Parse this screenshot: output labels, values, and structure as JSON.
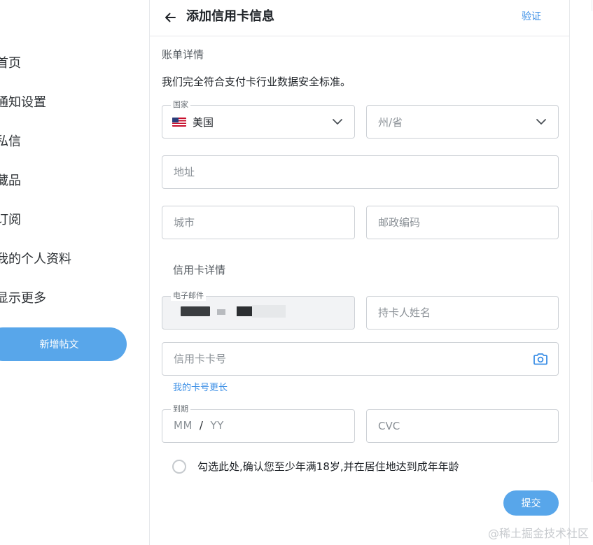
{
  "sidebar": {
    "items": [
      {
        "label": "首页"
      },
      {
        "label": "通知设置"
      },
      {
        "label": "私信"
      },
      {
        "label": "藏品"
      },
      {
        "label": "订阅"
      },
      {
        "label": "我的个人资料"
      },
      {
        "label": "显示更多"
      }
    ],
    "post_button": "新增帖文"
  },
  "header": {
    "title": "添加信用卡信息",
    "verify_label": "验证",
    "back_icon": "arrow-left-icon"
  },
  "billing": {
    "section_title": "账单详情",
    "note": "我们完全符合支付卡行业数据安全标准。",
    "country": {
      "label": "国家",
      "value": "美国",
      "flag_icon": "us-flag-icon"
    },
    "state": {
      "placeholder": "州/省"
    },
    "address": {
      "placeholder": "地址"
    },
    "city": {
      "placeholder": "城市"
    },
    "zip": {
      "placeholder": "邮政编码"
    }
  },
  "card": {
    "section_title": "信用卡详情",
    "email": {
      "label": "电子邮件",
      "value": ""
    },
    "holder": {
      "placeholder": "持卡人姓名"
    },
    "number": {
      "placeholder": "信用卡卡号",
      "camera_icon": "camera-icon"
    },
    "longer_link": "我的卡号更长",
    "expiry": {
      "label": "到期",
      "month": "MM",
      "slash": "/",
      "year": "YY"
    },
    "cvc": {
      "placeholder": "CVC"
    }
  },
  "age_confirm": {
    "label": "勾选此处,确认您至少年满18岁,并在居住地达到成年年龄",
    "checked": false
  },
  "submit_label": "提交",
  "watermark": "@稀土掘金技术社区",
  "colors": {
    "accent": "#58a6ea",
    "link": "#3a8ee6",
    "border": "#cdd1d6"
  }
}
